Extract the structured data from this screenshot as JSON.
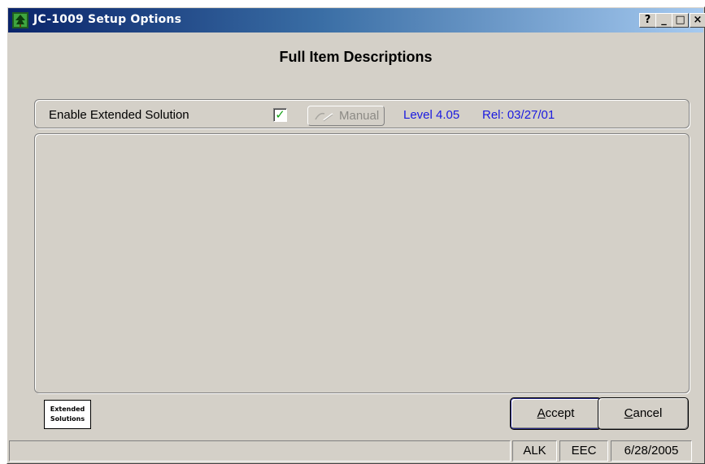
{
  "window": {
    "title": "JC-1009  Setup Options",
    "app_icon": "sage-tree-icon",
    "controls": {
      "help": "?",
      "minimize": "_",
      "maximize": "□",
      "close": "×"
    }
  },
  "heading": "Full Item Descriptions",
  "extended": {
    "enable_label": "Enable Extended Solution",
    "enabled": true,
    "check_glyph": "✓",
    "manual_label": "Manual",
    "level": "Level 4.05",
    "release": "Rel: 03/27/01",
    "info_color": "#1a1ae0"
  },
  "logo": {
    "line1": "Extended",
    "line2": "Solutions"
  },
  "buttons": {
    "accept": {
      "mnemonic": "A",
      "rest": "ccept"
    },
    "cancel": {
      "mnemonic": "C",
      "rest": "ancel"
    }
  },
  "statusbar": {
    "message": "",
    "user": "ALK",
    "company": "EEC",
    "date": "6/28/2005"
  },
  "colors": {
    "face": "#d4d0c8",
    "title_gradient_start": "#0a246a",
    "title_gradient_end": "#a6caf0",
    "check_color": "#16a016"
  }
}
